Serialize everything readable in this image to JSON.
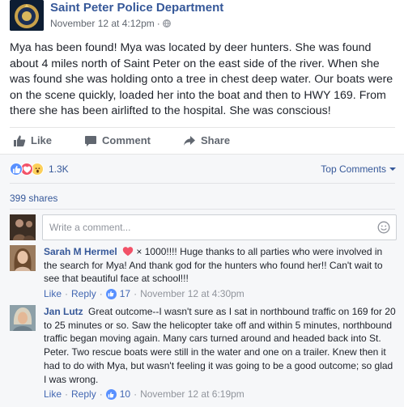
{
  "post": {
    "page_name": "Saint Peter Police Department",
    "timestamp": "November 12 at 4:12pm",
    "audience_icon": "globe-icon",
    "text": "Mya has been found! Mya was located by deer hunters. She was found about 4 miles north of Saint Peter on the east side of the river. When she was found she was holding onto a tree in chest deep water. Our boats were on the scene quickly, loaded her into the boat and then to HWY 169. From there she has been airlifted to the hospital. She was conscious!"
  },
  "actions": {
    "like_label": "Like",
    "comment_label": "Comment",
    "share_label": "Share"
  },
  "reactions": {
    "icons": [
      "like-icon",
      "love-icon",
      "wow-icon"
    ],
    "count": "1.3K",
    "sort_label": "Top Comments",
    "shares": "399 shares"
  },
  "composer": {
    "placeholder": "Write a comment..."
  },
  "comments": [
    {
      "author": "Sarah M Hermel",
      "text": "× 1000!!!! Huge thanks to all parties who were involved in the search for Mya! And thank god for the hunters who found her!! Can't wait to see that beautiful face at school!!!",
      "like_label": "Like",
      "reply_label": "Reply",
      "likes": "17",
      "time": "November 12 at 4:30pm",
      "colors": {
        "heart": "#f25268"
      }
    },
    {
      "author": "Jan Lutz",
      "text": "Great outcome--I wasn't sure as I sat in northbound traffic on 169 for 20 to 25 minutes or so. Saw the helicopter take off and within 5 minutes, northbound traffic began moving again. Many cars turned around and headed back into St. Peter. Two rescue boats were still in the water and one on a trailer. Knew then it had to do with Mya, but wasn't feeling it was going to be a good outcome; so glad I was wrong.",
      "like_label": "Like",
      "reply_label": "Reply",
      "likes": "10",
      "time": "November 12 at 6:19pm"
    }
  ],
  "colors": {
    "link_blue": "#365899",
    "meta_gray": "#616770",
    "comments_bg": "#f6f7f9",
    "like_blue": "#5890ff"
  }
}
